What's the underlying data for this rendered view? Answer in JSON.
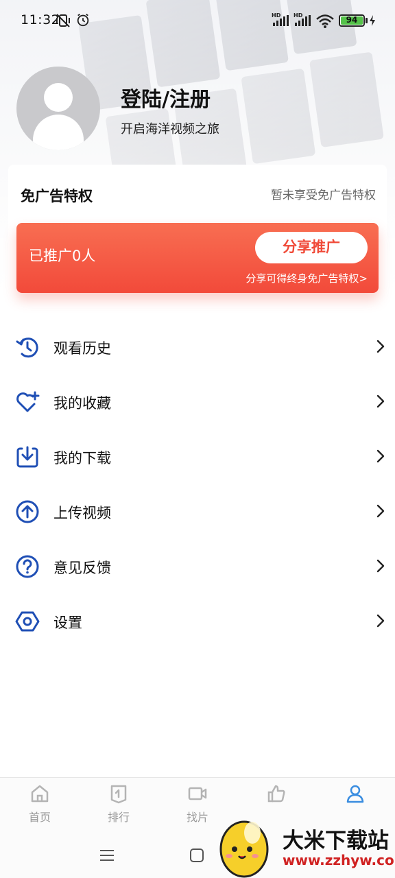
{
  "status_bar": {
    "time": "11:32",
    "battery": "94",
    "hd1": "HD",
    "hd2": "HD"
  },
  "profile": {
    "login_title": "登陆/注册",
    "subtitle": "开启海洋视频之旅"
  },
  "privilege": {
    "title": "免广告特权",
    "status": "暂未享受免广告特权",
    "promoted_count": "已推广0人",
    "share_button": "分享推广",
    "share_link": "分享可得终身免广告特权>"
  },
  "menu": {
    "items": [
      {
        "label": "观看历史",
        "icon": "history-icon"
      },
      {
        "label": "我的收藏",
        "icon": "favorite-heart-icon"
      },
      {
        "label": "我的下载",
        "icon": "download-icon"
      },
      {
        "label": "上传视频",
        "icon": "upload-icon"
      },
      {
        "label": "意见反馈",
        "icon": "feedback-question-icon"
      },
      {
        "label": "设置",
        "icon": "settings-hexagon-icon"
      }
    ]
  },
  "bottom_nav": {
    "items": [
      {
        "label": "首页",
        "icon": "home-icon"
      },
      {
        "label": "排行",
        "icon": "ranking-icon"
      },
      {
        "label": "找片",
        "icon": "video-camera-icon"
      },
      {
        "label": "",
        "icon": "thumbs-up-icon"
      },
      {
        "label": "",
        "icon": "user-icon"
      }
    ],
    "active_index": 4
  },
  "watermark": {
    "name": "大米下载站",
    "url": "www.zzhyw.com"
  },
  "colors": {
    "accent": "#1f4fb5",
    "promo_red": "#f24a3a",
    "nav_active": "#3a8de0"
  }
}
